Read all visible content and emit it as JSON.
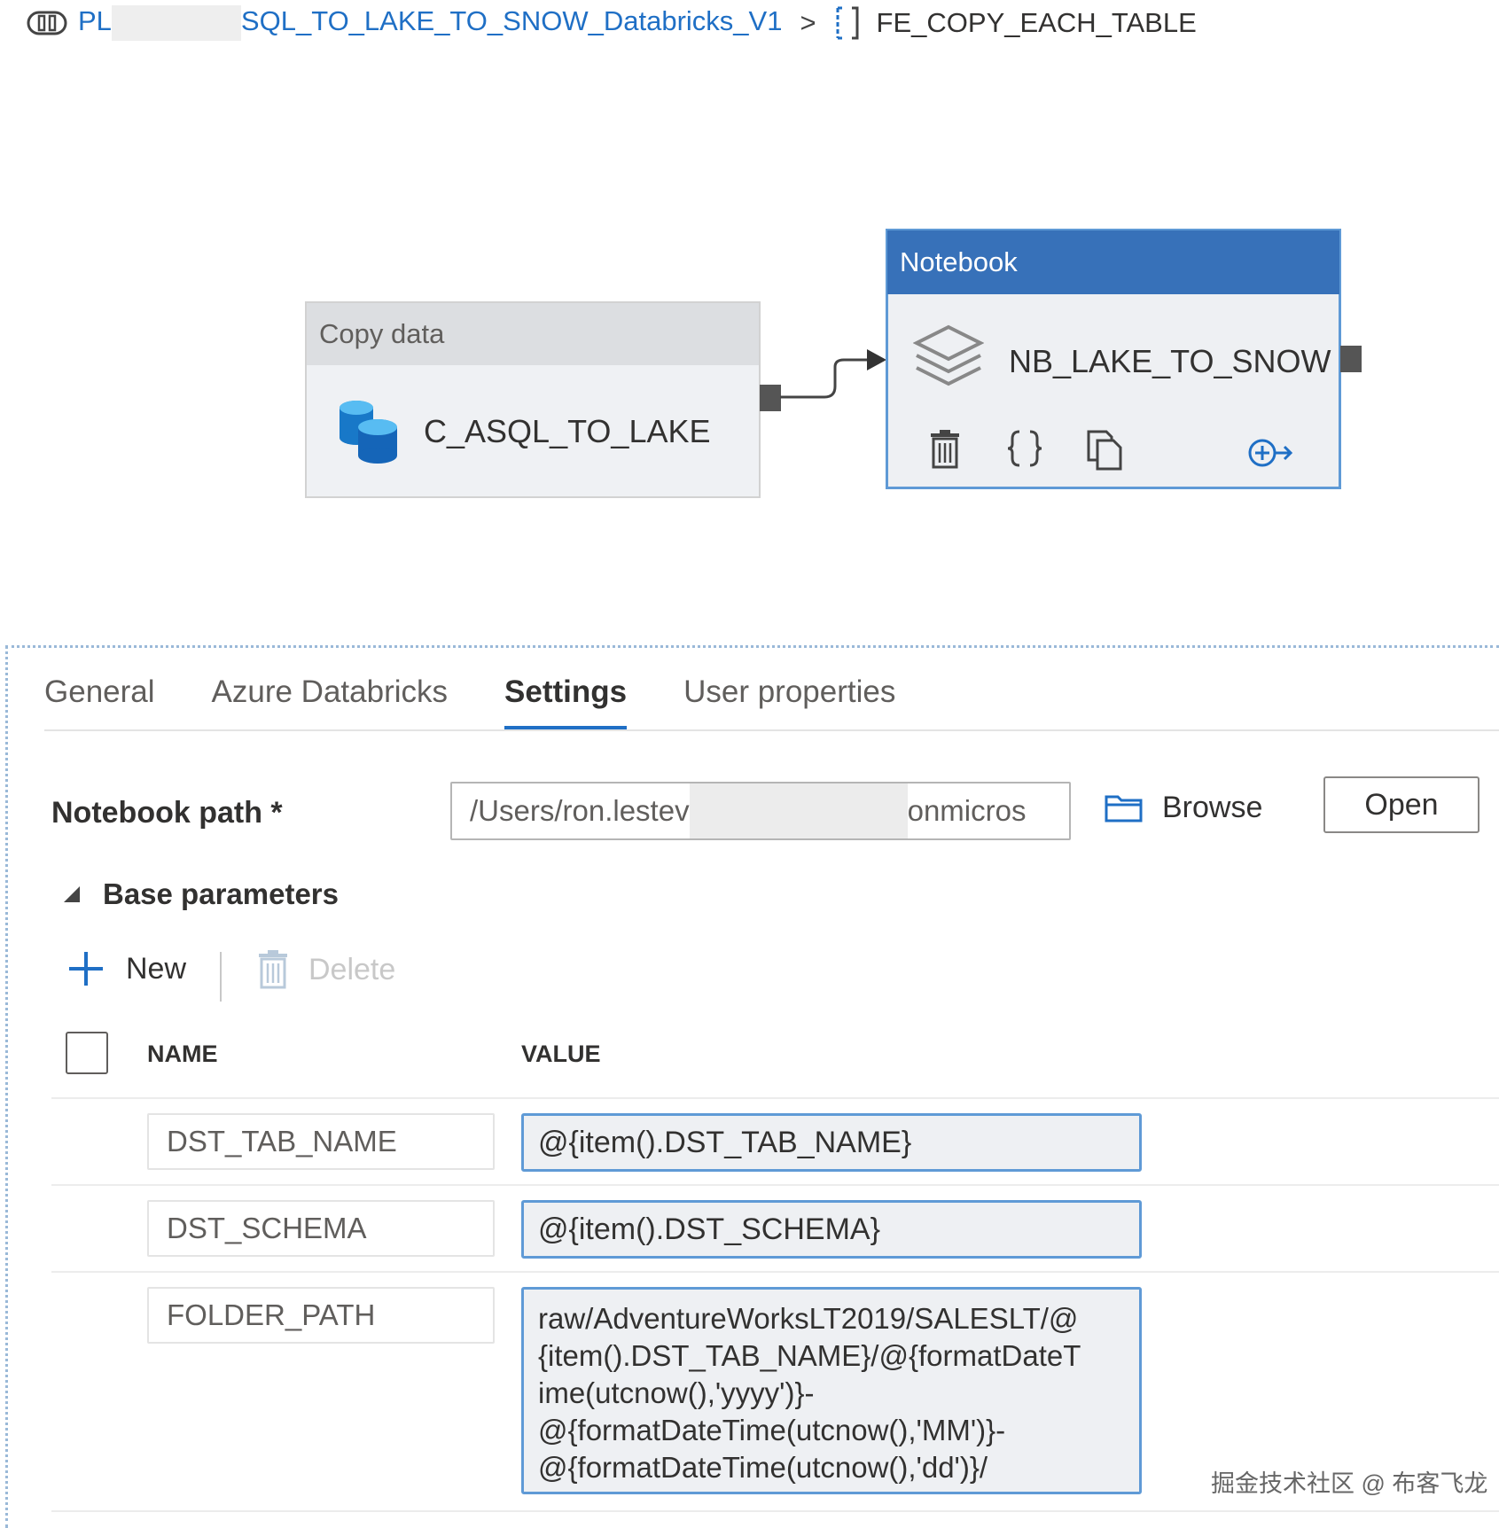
{
  "breadcrumb": {
    "pipeline_prefix": "PL",
    "pipeline_suffix": "SQL_TO_LAKE_TO_SNOW_Databricks_V1",
    "separator": ">",
    "current": "FE_COPY_EACH_TABLE"
  },
  "canvas": {
    "copy_activity": {
      "type_label": "Copy data",
      "name": "C_ASQL_TO_LAKE"
    },
    "notebook_activity": {
      "type_label": "Notebook",
      "name": "NB_LAKE_TO_SNOW"
    }
  },
  "tabs": [
    {
      "label": "General"
    },
    {
      "label": "Azure Databricks"
    },
    {
      "label": "Settings",
      "active": true
    },
    {
      "label": "User properties"
    }
  ],
  "settings": {
    "notebook_path_label": "Notebook path *",
    "notebook_path_start": "/Users/ron.lestev",
    "notebook_path_end": "onmicros",
    "browse_label": "Browse",
    "open_label": "Open",
    "base_parameters_label": "Base parameters",
    "new_label": "New",
    "delete_label": "Delete",
    "columns": {
      "name": "NAME",
      "value": "VALUE"
    },
    "params": [
      {
        "name": "DST_TAB_NAME",
        "value": "@{item().DST_TAB_NAME}"
      },
      {
        "name": "DST_SCHEMA",
        "value": "@{item().DST_SCHEMA}"
      },
      {
        "name": "FOLDER_PATH",
        "value_lines": [
          "raw/AdventureWorksLT2019/SALESLT/@",
          "{item().DST_TAB_NAME}/@{formatDateT",
          "ime(utcnow(),'yyyy')}-",
          "@{formatDateTime(utcnow(),'MM')}-",
          "@{formatDateTime(utcnow(),'dd')}/"
        ]
      }
    ]
  },
  "watermark": "掘金技术社区 @ 布客飞龙",
  "colors": {
    "accent": "#1f6fc5",
    "notebook_header": "#3771b9",
    "field_border": "#5f9ad6"
  }
}
